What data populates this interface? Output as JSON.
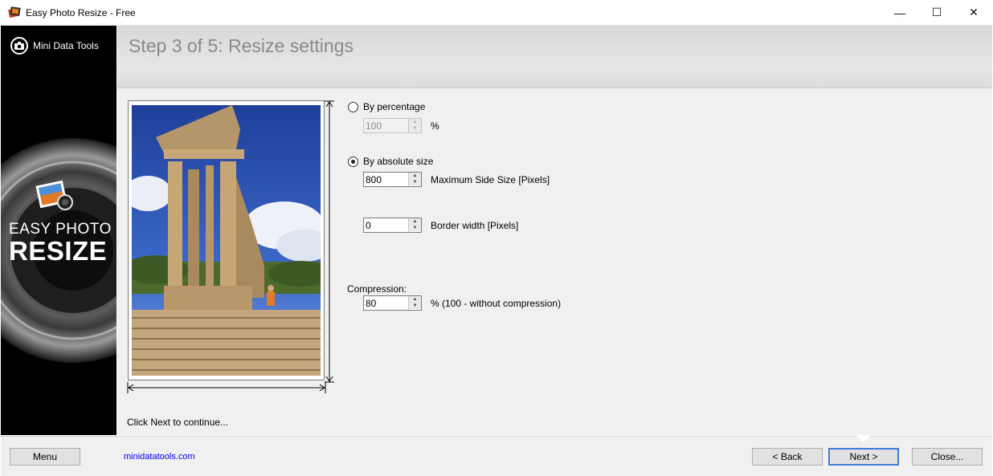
{
  "window": {
    "title": "Easy Photo Resize - Free",
    "minimize_glyph": "—",
    "maximize_glyph": "☐",
    "close_glyph": "✕"
  },
  "sidebar": {
    "brand": "Mini Data Tools",
    "logo_line1": "EASY PHOTO",
    "logo_line2": "RESIZE"
  },
  "header": {
    "step_title": "Step 3 of 5: Resize settings"
  },
  "settings": {
    "by_percentage": {
      "label": "By percentage",
      "selected": false,
      "value": "100",
      "unit": "%"
    },
    "by_absolute": {
      "label": "By absolute size",
      "selected": true
    },
    "max_side": {
      "value": "800",
      "label": "Maximum Side Size [Pixels]"
    },
    "border_width": {
      "value": "0",
      "label": "Border width [Pixels]"
    },
    "compression": {
      "heading": "Compression:",
      "value": "80",
      "label": "% (100 - without compression)"
    }
  },
  "hint": "Click Next to continue...",
  "footer": {
    "menu": "Menu",
    "link": "minidatatools.com",
    "back": "< Back",
    "next": "Next >",
    "close": "Close..."
  },
  "colors": {
    "accent_border": "#3c7fd6",
    "link": "#0000ee"
  }
}
